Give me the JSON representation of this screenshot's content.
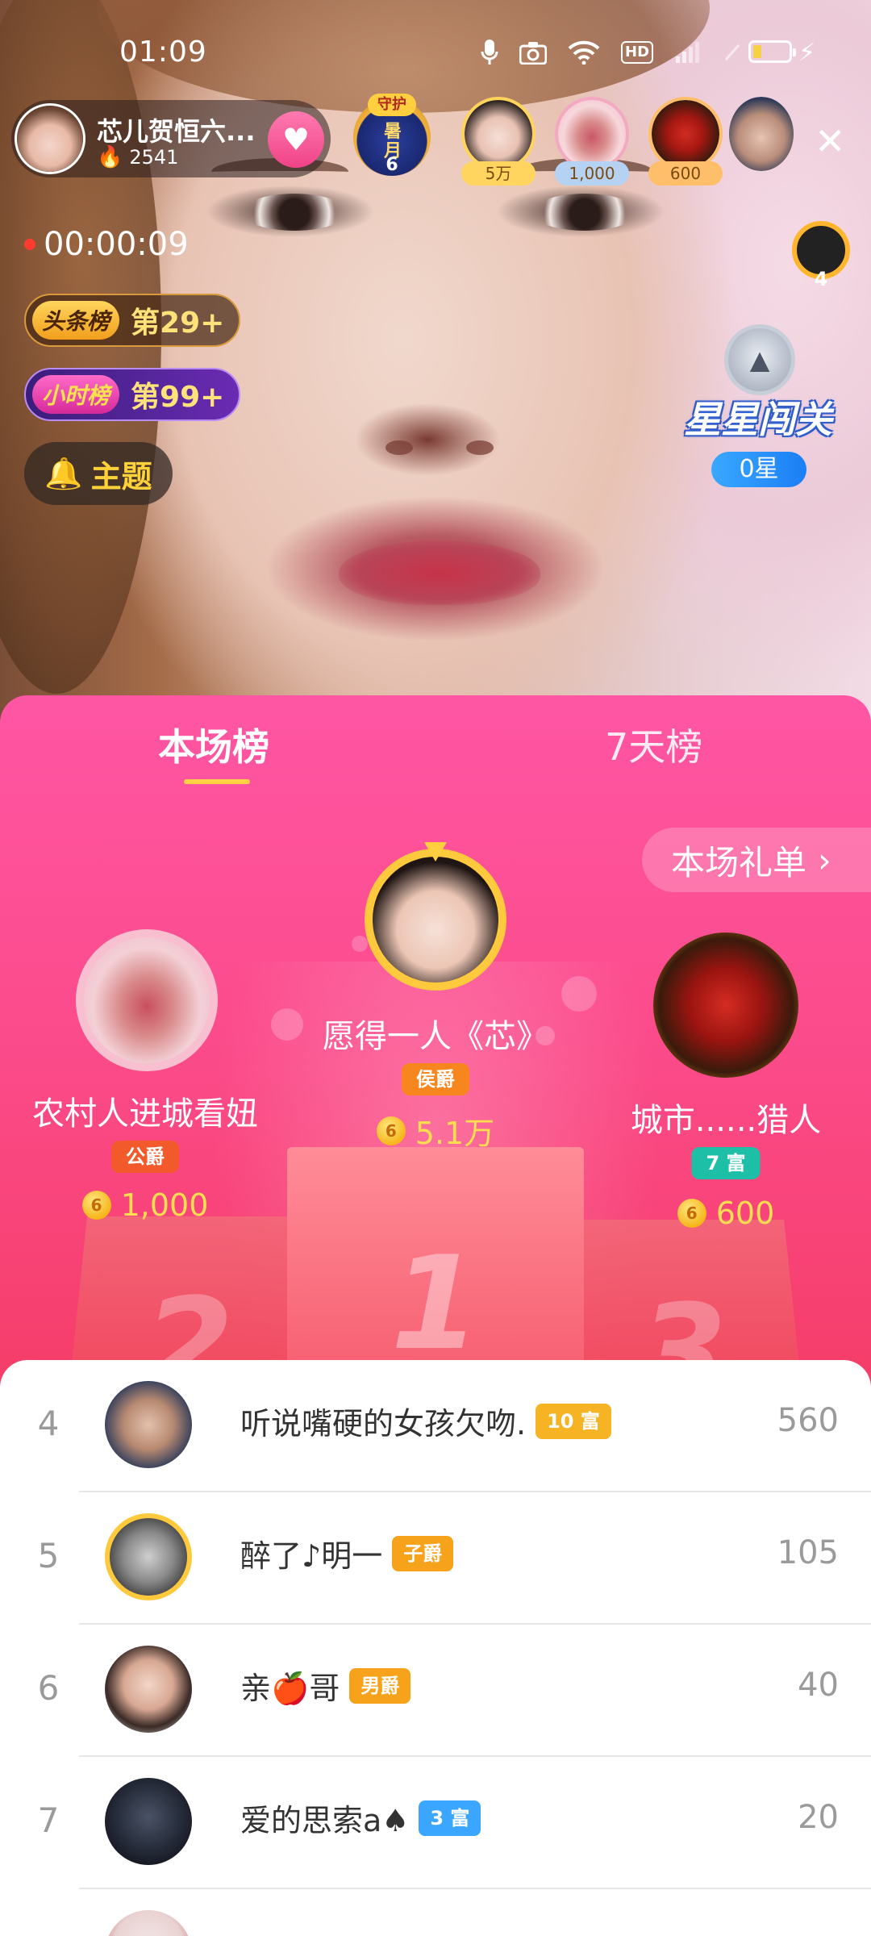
{
  "status_bar": {
    "time": "01:09",
    "hd_label": "HD"
  },
  "host": {
    "name": "芯儿贺恒六...",
    "heat": "2541"
  },
  "guard_badge": {
    "label": "守护",
    "month_text": "暑月",
    "number": "6"
  },
  "top_viewers": [
    {
      "count": "5万",
      "color": "#ffd560"
    },
    {
      "count": "1,000",
      "color": "#b6d2f2"
    },
    {
      "count": "600",
      "color": "#ffbe6a"
    },
    {
      "count": "",
      "color": ""
    }
  ],
  "live_timer": "00:00:09",
  "ranks": {
    "headline": {
      "badge": "头条榜",
      "text": "第29+"
    },
    "hourly": {
      "badge": "小时榜",
      "text": "第99+"
    }
  },
  "theme_button": "主题",
  "side_guard_number": "4",
  "star_game": {
    "title": "星星闯关",
    "stars": "0星"
  },
  "panel": {
    "tabs": [
      {
        "label": "本场榜",
        "active": true
      },
      {
        "label": "7天榜",
        "active": false
      }
    ],
    "gift_list_label": "本场礼单",
    "top3": {
      "first": {
        "name": "愿得一人《芯》",
        "badge": "侯爵",
        "score": "5.1万",
        "badge_color": "#f7861e"
      },
      "second": {
        "name": "农村人进城看妞",
        "badge": "公爵",
        "score": "1,000",
        "badge_color": "#f25a2b"
      },
      "third": {
        "name": "城市......猎人",
        "badge": "7 富",
        "score": "600",
        "badge_color": "#1dbfa7"
      }
    },
    "podium_numbers": [
      "1",
      "2",
      "3"
    ]
  },
  "list": [
    {
      "rank": "4",
      "name": "听说嘴硬的女孩欠吻.",
      "badge": "10 富",
      "badge_color": "#f6b425",
      "value": "560"
    },
    {
      "rank": "5",
      "name": "醉了♪明一",
      "badge": "子爵",
      "badge_color": "#f7a21b",
      "value": "105"
    },
    {
      "rank": "6",
      "name": "亲🍎哥",
      "badge": "男爵",
      "badge_color": "#f7a21b",
      "value": "40"
    },
    {
      "rank": "7",
      "name": "爱的思索a♠",
      "badge": "3 富",
      "badge_color": "#3aa6ff",
      "value": "20"
    }
  ]
}
